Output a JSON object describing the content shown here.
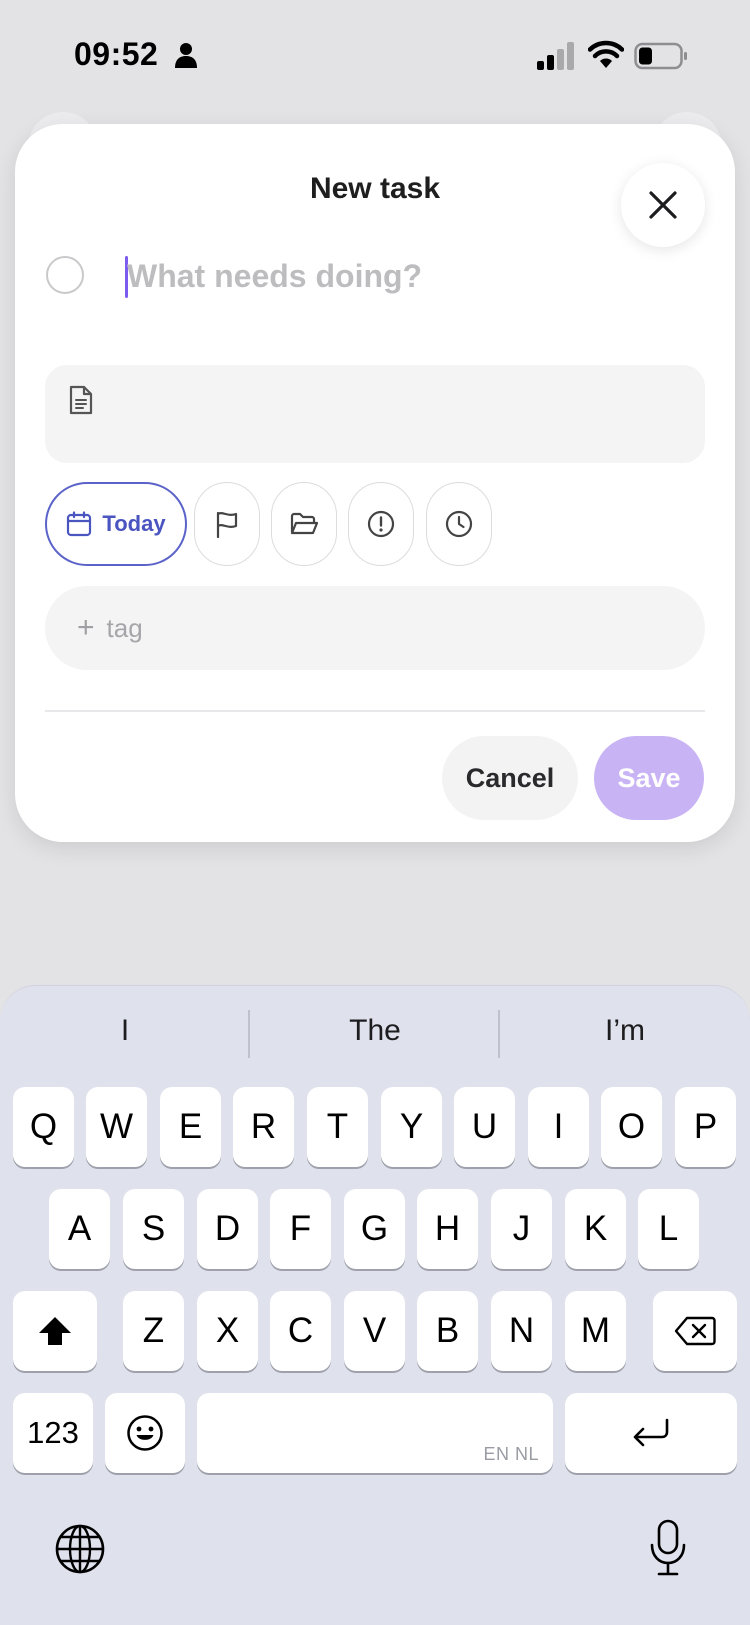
{
  "status_bar": {
    "time": "09:52",
    "icons": [
      "person-icon",
      "cellular-signal-icon",
      "wifi-icon",
      "battery-icon"
    ]
  },
  "modal": {
    "title": "New task",
    "task_input": {
      "value": "",
      "placeholder": "What needs doing?"
    },
    "chips": {
      "today_label": "Today",
      "icons": [
        "calendar-icon",
        "flag-icon",
        "folder-icon",
        "priority-icon",
        "clock-icon"
      ]
    },
    "tag": {
      "plus": "+",
      "label": "tag"
    },
    "actions": {
      "cancel_label": "Cancel",
      "save_label": "Save"
    }
  },
  "keyboard": {
    "suggestions": [
      "I",
      "The",
      "I’m"
    ],
    "rows": [
      [
        "Q",
        "W",
        "E",
        "R",
        "T",
        "Y",
        "U",
        "I",
        "O",
        "P"
      ],
      [
        "A",
        "S",
        "D",
        "F",
        "G",
        "H",
        "J",
        "K",
        "L"
      ],
      [
        "Z",
        "X",
        "C",
        "V",
        "B",
        "N",
        "M"
      ]
    ],
    "numbers_label": "123",
    "space_language": "EN NL",
    "icons": [
      "shift-icon",
      "backspace-icon",
      "emoji-icon",
      "return-icon",
      "globe-icon",
      "microphone-icon"
    ]
  },
  "colors": {
    "accent": "#5b63c9",
    "save_disabled": "#c8b3f5",
    "caret": "#7c5cf0",
    "keyboard_bg": "#dfe1ec"
  }
}
